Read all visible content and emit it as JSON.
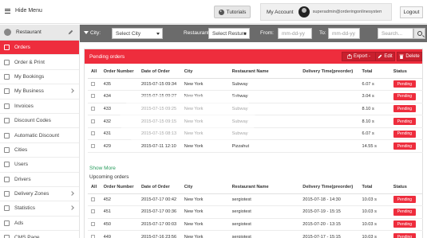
{
  "topbar": {
    "hide_menu": "Hide Menu",
    "tutorials": "Tutorials",
    "my_account": "My Account",
    "email": "superadmin@orderingonlinesystem.com",
    "logout": "Logout"
  },
  "sidebar": {
    "header": "Restaurant",
    "items": [
      {
        "label": "Orders",
        "active": true,
        "icon": "orders-icon"
      },
      {
        "label": "Order & Print",
        "icon": "print-icon"
      },
      {
        "label": "My Bookings",
        "icon": "bookings-icon"
      },
      {
        "label": "My Business",
        "icon": "business-icon",
        "chevron": true
      },
      {
        "label": "Invoices",
        "icon": "invoice-icon"
      },
      {
        "label": "Discount Codes",
        "icon": "discount-icon"
      },
      {
        "label": "Automatic Discount",
        "icon": "auto-discount-icon"
      },
      {
        "label": "Cities",
        "icon": "cities-icon"
      },
      {
        "label": "Users",
        "icon": "users-icon"
      },
      {
        "label": "Drivers",
        "icon": "drivers-icon"
      },
      {
        "label": "Delivery Zones",
        "icon": "delivery-zones-icon",
        "chevron": true
      },
      {
        "label": "Statistics",
        "icon": "statistics-icon",
        "chevron": true
      },
      {
        "label": "Ads",
        "icon": "ads-icon"
      },
      {
        "label": "CMS Page",
        "icon": "cms-icon"
      }
    ]
  },
  "filter": {
    "city_label": "City:",
    "city_value": "Select City",
    "restaurant_label": "Restaurant :",
    "restaurant_value": "Select Restura",
    "from_label": "From:",
    "from_placeholder": "mm-dd-yy",
    "to_label": "To:",
    "to_placeholder": "mm-dd-yy",
    "search_placeholder": "Search..."
  },
  "panel": {
    "title": "Pending orders",
    "export": "Export -",
    "edit": "Edit",
    "delete": "Delete",
    "show_more": "Show More",
    "upcoming_title": "Upcoming orders"
  },
  "columns": [
    "All",
    "Order Number",
    "Date of Order",
    "City",
    "Restaurant Name",
    "Delivery Time(preorder)",
    "Total",
    "Status"
  ],
  "pending_orders": [
    {
      "num": "435",
      "date": "2015-07-15 09:34",
      "city": "New York",
      "rest": "Subway",
      "delivery": "",
      "total": "6.07 s",
      "status": "Pending"
    },
    {
      "num": "434",
      "date": "2015-07-15 09:27",
      "city": "New York",
      "rest": "Subway",
      "delivery": "",
      "total": "3.04 s",
      "status": "Pending"
    },
    {
      "num": "433",
      "date": "2015-07-15 09:25",
      "city": "New York",
      "rest": "Subway",
      "delivery": "",
      "total": "8.10 s",
      "status": "Pending"
    },
    {
      "num": "432",
      "date": "2015-07-15 09:15",
      "city": "New York",
      "rest": "Subway",
      "delivery": "",
      "total": "8.10 s",
      "status": "Pending"
    },
    {
      "num": "431",
      "date": "2015-07-15 08:13",
      "city": "New York",
      "rest": "Subway",
      "delivery": "",
      "total": "6.07 s",
      "status": "Pending"
    },
    {
      "num": "429",
      "date": "2015-07-11 12:10",
      "city": "New York",
      "rest": "Pizzahut",
      "delivery": "",
      "total": "14.55 s",
      "status": "Pending"
    }
  ],
  "upcoming_orders": [
    {
      "num": "452",
      "date": "2015-07-17 00:42",
      "city": "New York",
      "rest": "sergiotest",
      "delivery": "2015-07-18 - 14:30",
      "total": "10.03 s",
      "status": "Pending"
    },
    {
      "num": "451",
      "date": "2015-07-17 00:36",
      "city": "New York",
      "rest": "sergiotest",
      "delivery": "2015-07-19 - 15:15",
      "total": "10.03 s",
      "status": "Pending"
    },
    {
      "num": "450",
      "date": "2015-07-17 00:03",
      "city": "New York",
      "rest": "sergiotest",
      "delivery": "2015-07-20 - 13:15",
      "total": "10.03 s",
      "status": "Pending"
    },
    {
      "num": "449",
      "date": "2015-07-16 23:56",
      "city": "New York",
      "rest": "sergiotest",
      "delivery": "2015-07-17 - 15:15",
      "total": "10.03 s",
      "status": "Pending"
    }
  ],
  "colors": {
    "accent": "#ee2d3d",
    "filterbar": "#6b6b6b"
  }
}
